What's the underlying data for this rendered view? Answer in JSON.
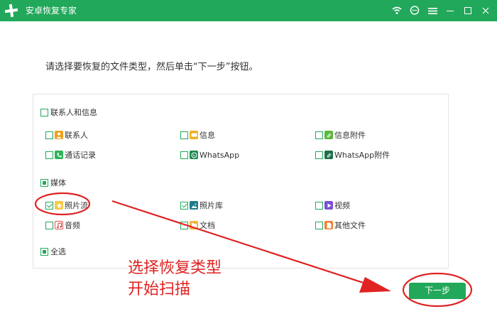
{
  "window": {
    "title": "安卓恢复专家",
    "accent_color": "#22a85a",
    "controls": [
      "wifi-icon",
      "chat-icon",
      "menu-icon",
      "minimize-icon",
      "maximize-icon",
      "close-icon"
    ]
  },
  "instruction": "请选择要恢复的文件类型，然后单击“下一步”按钮。",
  "groups": {
    "contacts": {
      "label": "联系人和信息",
      "state": "unchecked",
      "items": [
        {
          "label": "联系人",
          "icon": "contacts-icon",
          "checked": false
        },
        {
          "label": "信息",
          "icon": "messages-icon",
          "checked": false
        },
        {
          "label": "信息附件",
          "icon": "message-attachment-icon",
          "checked": false
        },
        {
          "label": "通话记录",
          "icon": "call-log-icon",
          "checked": false
        },
        {
          "label": "WhatsApp",
          "icon": "whatsapp-icon",
          "checked": false
        },
        {
          "label": "WhatsApp附件",
          "icon": "whatsapp-attachment-icon",
          "checked": false
        }
      ]
    },
    "media": {
      "label": "媒体",
      "state": "partial",
      "items": [
        {
          "label": "照片流",
          "icon": "photo-stream-icon",
          "checked": true
        },
        {
          "label": "照片库",
          "icon": "photo-library-icon",
          "checked": true
        },
        {
          "label": "视频",
          "icon": "video-icon",
          "checked": false
        },
        {
          "label": "音频",
          "icon": "audio-icon",
          "checked": false
        },
        {
          "label": "文档",
          "icon": "document-icon",
          "checked": false
        },
        {
          "label": "其他文件",
          "icon": "other-files-icon",
          "checked": false
        }
      ]
    },
    "select_all": {
      "label": "全选",
      "state": "partial"
    }
  },
  "next_button": {
    "label": "下一步"
  },
  "annotation": {
    "line1": "选择恢复类型",
    "line2": "开始扫描",
    "color": "#e02222"
  }
}
